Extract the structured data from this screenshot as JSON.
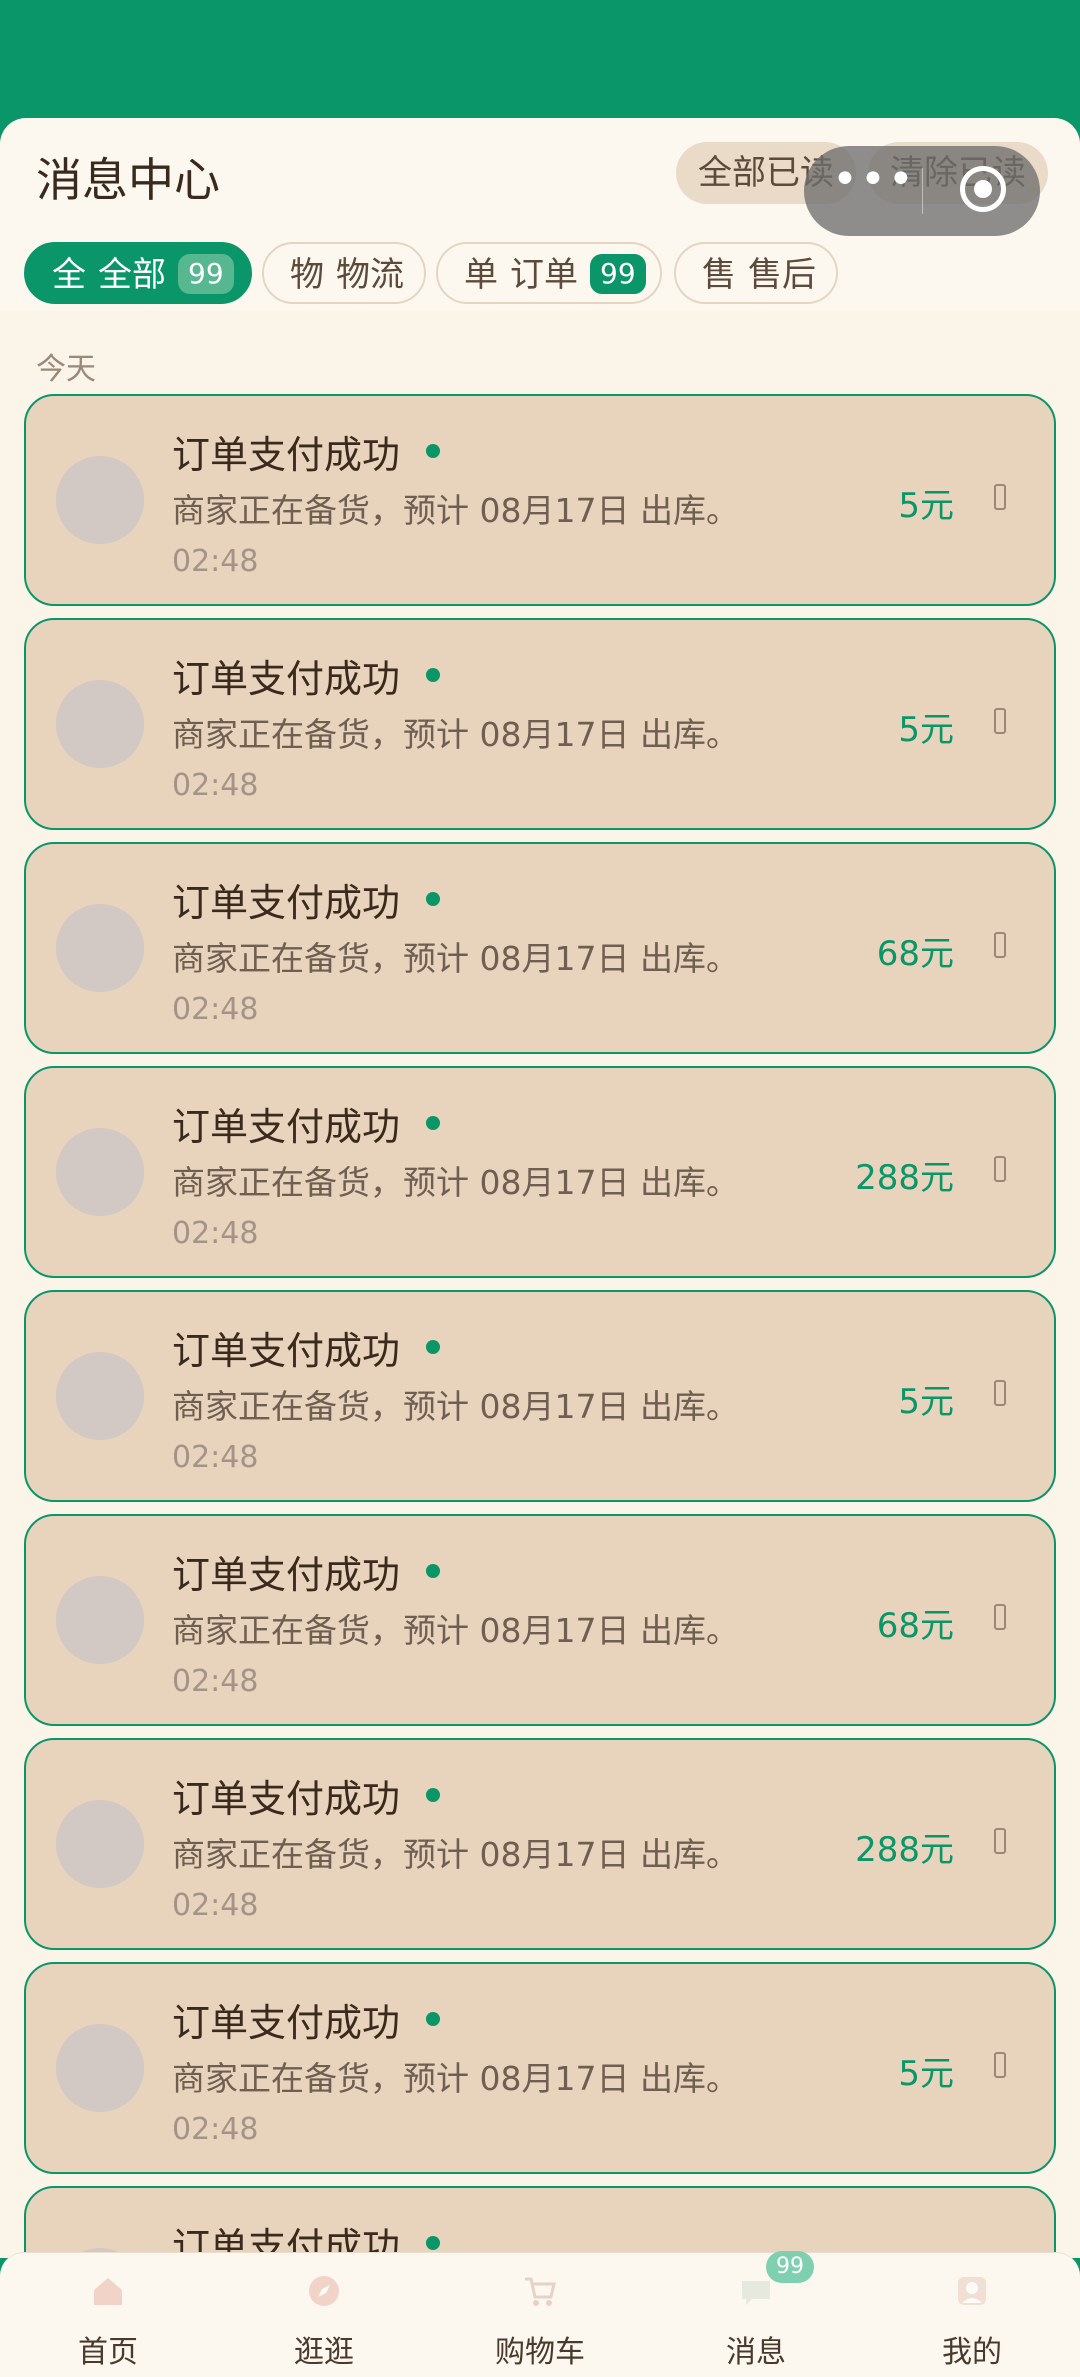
{
  "header": {
    "title": "消息中心",
    "mark_all_read": "全部已读",
    "clear_read": "清除已读"
  },
  "tabs": [
    {
      "prefix": "全",
      "label": "全部",
      "badge": "99",
      "active": true
    },
    {
      "prefix": "物",
      "label": "物流",
      "badge": "",
      "active": false
    },
    {
      "prefix": "单",
      "label": "订单",
      "badge": "99",
      "active": false
    },
    {
      "prefix": "售",
      "label": "售后",
      "badge": "",
      "active": false
    }
  ],
  "section_label": "今天",
  "messages": [
    {
      "title": "订单支付成功",
      "desc": "商家正在备货，预计 08月17日 出库。",
      "time": "02:48",
      "amount": "5元"
    },
    {
      "title": "订单支付成功",
      "desc": "商家正在备货，预计 08月17日 出库。",
      "time": "02:48",
      "amount": "5元"
    },
    {
      "title": "订单支付成功",
      "desc": "商家正在备货，预计 08月17日 出库。",
      "time": "02:48",
      "amount": "68元"
    },
    {
      "title": "订单支付成功",
      "desc": "商家正在备货，预计 08月17日 出库。",
      "time": "02:48",
      "amount": "288元"
    },
    {
      "title": "订单支付成功",
      "desc": "商家正在备货，预计 08月17日 出库。",
      "time": "02:48",
      "amount": "5元"
    },
    {
      "title": "订单支付成功",
      "desc": "商家正在备货，预计 08月17日 出库。",
      "time": "02:48",
      "amount": "68元"
    },
    {
      "title": "订单支付成功",
      "desc": "商家正在备货，预计 08月17日 出库。",
      "time": "02:48",
      "amount": "288元"
    },
    {
      "title": "订单支付成功",
      "desc": "商家正在备货，预计 08月17日 出库。",
      "time": "02:48",
      "amount": "5元"
    },
    {
      "title": "订单支付成功",
      "desc": "",
      "time": "",
      "amount": ""
    }
  ],
  "tabbar": [
    {
      "label": "首页",
      "icon": "home-icon"
    },
    {
      "label": "逛逛",
      "icon": "compass-icon"
    },
    {
      "label": "购物车",
      "icon": "cart-icon"
    },
    {
      "label": "消息",
      "icon": "chat-icon",
      "badge": "99"
    },
    {
      "label": "我的",
      "icon": "user-icon"
    }
  ],
  "colors": {
    "primary": "#0a9669",
    "card": "#e8d3bc",
    "background": "#fdf8ef"
  }
}
